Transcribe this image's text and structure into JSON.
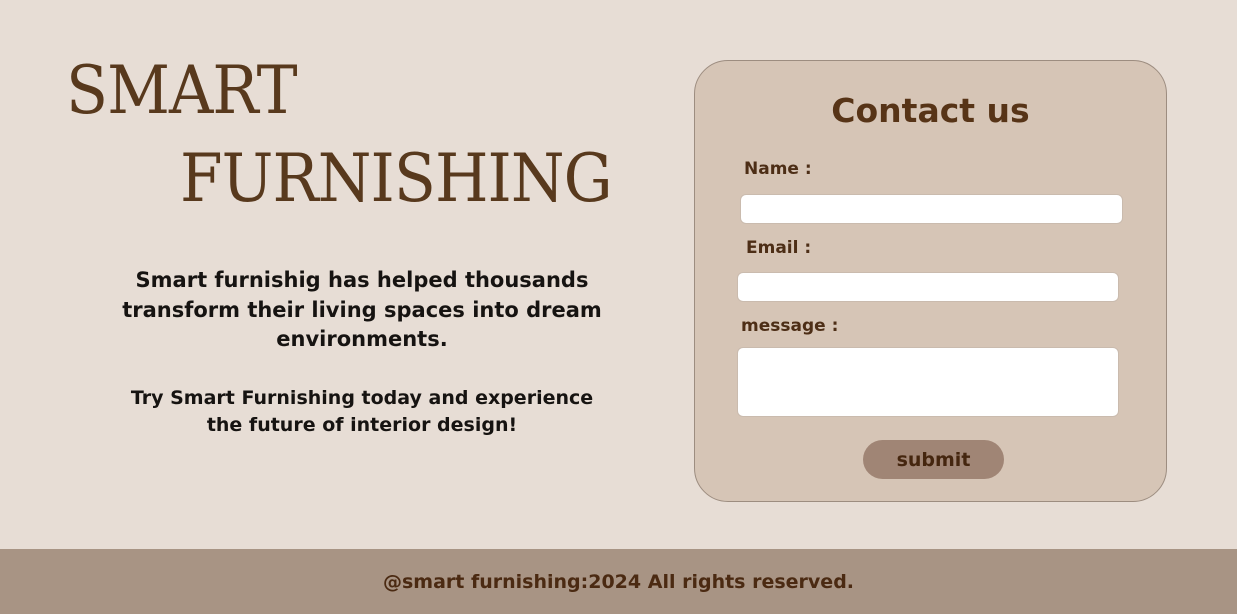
{
  "brand": {
    "line1": "SMART",
    "line2": "FURNISHING"
  },
  "intro": {
    "paragraph1": "Smart furnishig has helped thousands transform their living spaces into dream environments.",
    "paragraph2": "Try Smart Furnishing today and experience the future of interior design!"
  },
  "contact": {
    "title": "Contact us",
    "name_label": "Name :",
    "name_value": "",
    "email_label": "Email :",
    "email_value": "",
    "message_label": "message :",
    "message_value": "",
    "submit_label": "submit"
  },
  "footer": {
    "text": "@smart furnishing:2024 All rights reserved."
  }
}
